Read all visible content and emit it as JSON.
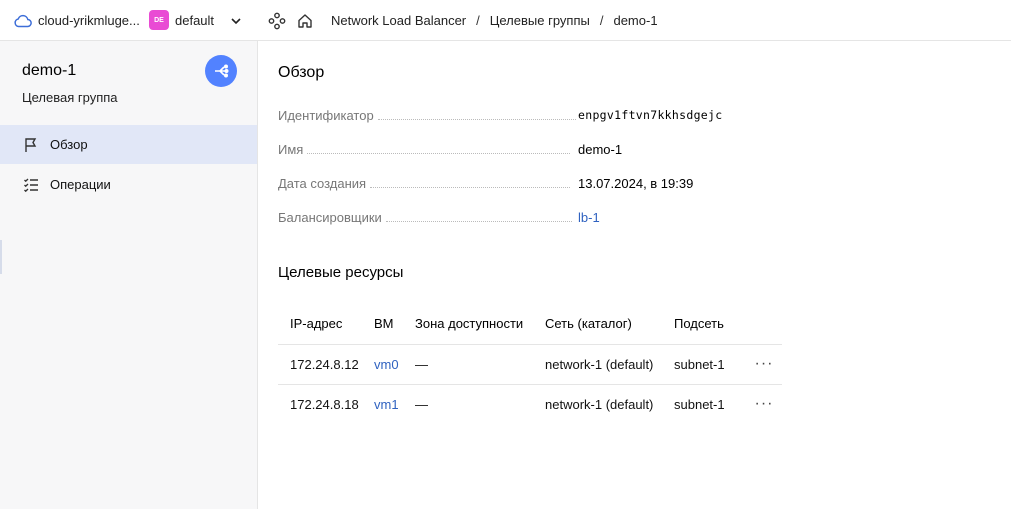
{
  "header": {
    "cloud_name": "cloud-yrikmluge...",
    "folder_badge": "DE",
    "folder_name": "default",
    "breadcrumbs": [
      "Network Load Balancer",
      "Целевые группы",
      "demo-1"
    ],
    "breadcrumb_separator": "/"
  },
  "sidebar": {
    "title": "demo-1",
    "subtitle": "Целевая группа",
    "items": [
      {
        "label": "Обзор",
        "icon": "flag-icon",
        "active": true
      },
      {
        "label": "Операции",
        "icon": "list-checks-icon",
        "active": false
      }
    ]
  },
  "main": {
    "title": "Обзор",
    "properties": [
      {
        "key": "Идентификатор",
        "value": "enpgv1ftvn7kkhsdgejc"
      },
      {
        "key": "Имя",
        "value": "demo-1"
      },
      {
        "key": "Дата создания",
        "value": "13.07.2024, в 19:39"
      },
      {
        "key": "Балансировщики",
        "value": "lb-1"
      }
    ],
    "resources_title": "Целевые ресурсы",
    "table": {
      "columns": [
        "IP-адрес",
        "ВМ",
        "Зона доступности",
        "Сеть (каталог)",
        "Подсеть"
      ],
      "rows": [
        {
          "ip": "172.24.8.12",
          "vm": "vm0",
          "zone": "—",
          "network": "network-1 (default)",
          "subnet": "subnet-1",
          "more": "···"
        },
        {
          "ip": "172.24.8.18",
          "vm": "vm1",
          "zone": "—",
          "network": "network-1 (default)",
          "subnet": "subnet-1",
          "more": "···"
        }
      ]
    }
  },
  "colors": {
    "accent": "#5282ff",
    "link": "#2f62c0",
    "active_nav": "#e1e7f7",
    "badge": "#e94bd4"
  }
}
